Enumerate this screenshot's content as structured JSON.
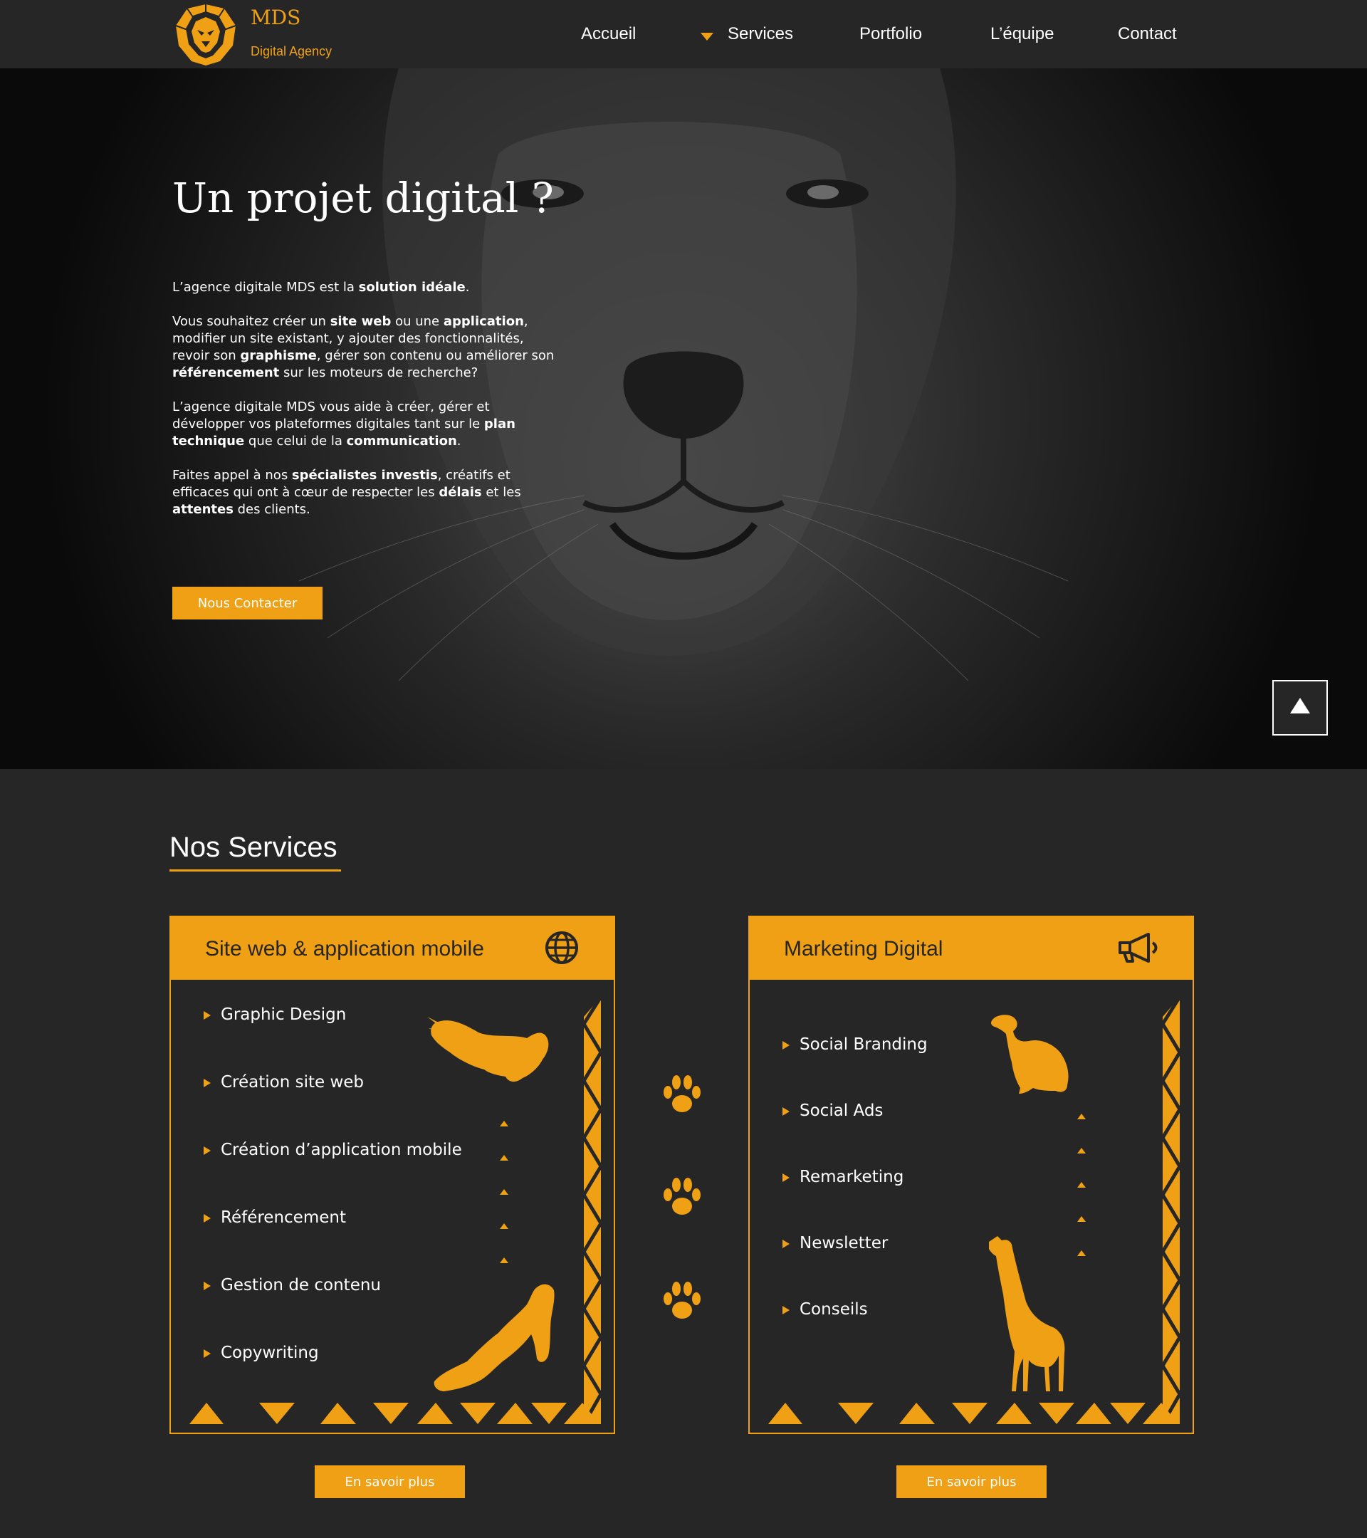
{
  "header": {
    "brand": "MDS",
    "tagline": "Digital Agency",
    "logo_icon": "lion-head-logo",
    "nav": [
      {
        "label": "Accueil"
      },
      {
        "label": "Services",
        "has_dropdown": true
      },
      {
        "label": "Portfolio"
      },
      {
        "label": "L’équipe"
      },
      {
        "label": "Contact"
      }
    ]
  },
  "hero": {
    "title": "Un projet digital ?",
    "p1": {
      "a": "L’agence digitale MDS est la ",
      "b": "solution idéale",
      "c": "."
    },
    "p2": {
      "a": "Vous souhaitez créer un ",
      "b": "site web",
      "c": " ou une ",
      "d": "application",
      "e": ", modifier un site existant, y ajouter des fonctionnalités, revoir son ",
      "f": "graphisme",
      "g": ", gérer son contenu ou améliorer son ",
      "h": "référencement",
      "i": " sur les moteurs de recherche?"
    },
    "p3": {
      "a": "L’agence digitale MDS vous aide à créer, gérer et développer vos plateformes digitales tant sur le ",
      "b": "plan technique",
      "c": " que celui de la ",
      "d": "communication",
      "e": "."
    },
    "p4": {
      "a": "Faites appel à nos ",
      "b": "spécialistes investis",
      "c": ", créatifs et efficaces qui ont à cœur de respecter les ",
      "d": "délais",
      "e": " et les ",
      "f": "attentes",
      "g": " des clients."
    },
    "cta": "Nous Contacter",
    "background": "lion-face-photo"
  },
  "back_to_top_icon": "arrow-up-icon",
  "services": {
    "title": "Nos Services",
    "cards": [
      {
        "title": "Site web & application mobile",
        "icon": "globe-icon",
        "items": [
          "Graphic Design",
          "Création site web",
          "Création d’application mobile",
          "Référencement",
          "Gestion de contenu",
          "Copywriting"
        ],
        "animals": [
          "eagle-silhouette",
          "lioness-silhouette"
        ],
        "button": "En savoir plus"
      },
      {
        "title": "Marketing Digital",
        "icon": "megaphone-icon",
        "items": [
          "Social Branding",
          "Social Ads",
          "Remarketing",
          "Newsletter",
          "Conseils"
        ],
        "animals": [
          "vulture-silhouette",
          "giraffe-silhouette"
        ],
        "button": "En savoir plus"
      }
    ],
    "paw_icons": [
      "paw-icon",
      "paw-icon",
      "paw-icon"
    ]
  },
  "colors": {
    "accent": "#f0a015",
    "background": "#262626",
    "text": "#ffffff"
  }
}
